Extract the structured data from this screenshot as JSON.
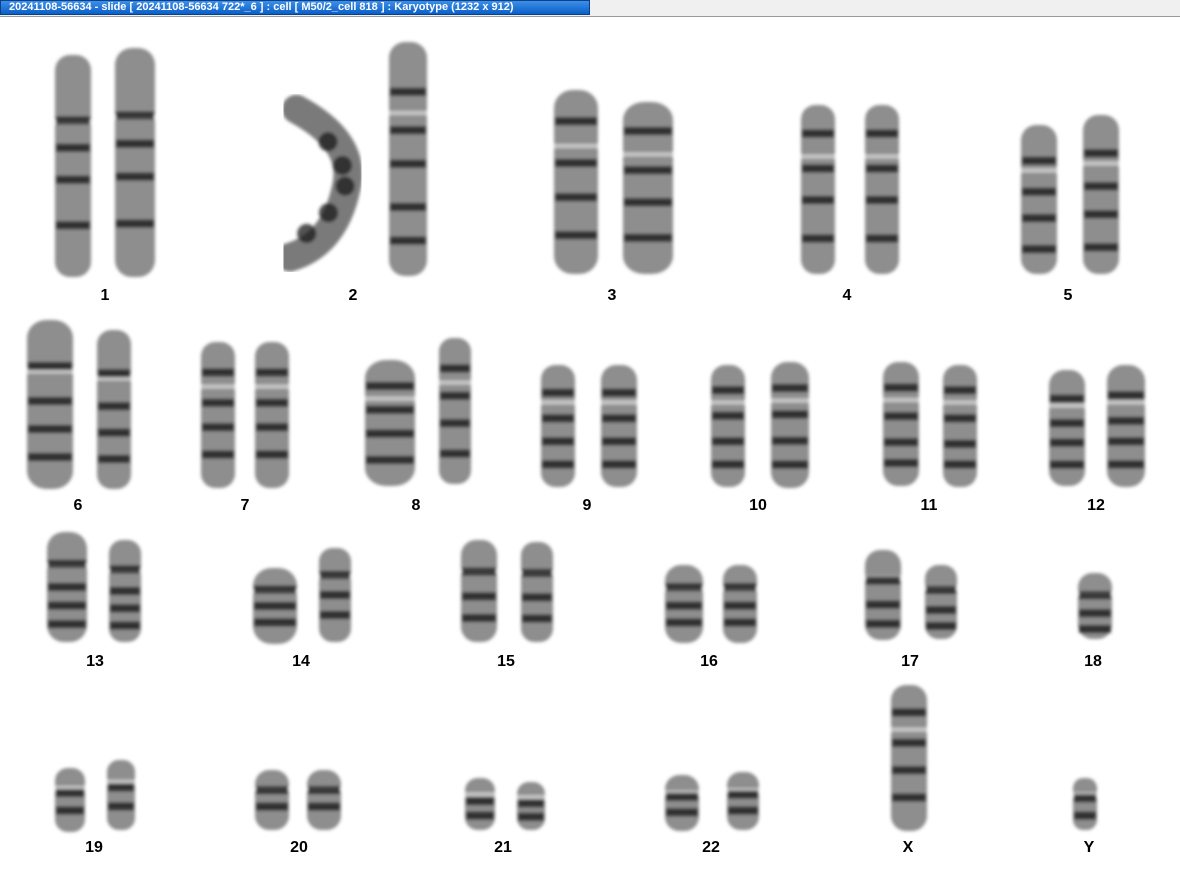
{
  "window": {
    "title": "20241108-56634 - slide [ 20241108-56634 722*_6 ] : cell [ M50/2_cell 818 ] : Karyotype  (1232 x 912)"
  },
  "colors": {
    "title_bar": "#1a6fd6",
    "chromosome": "#7a7a7a",
    "band": "#1a1a1a"
  },
  "karyotype": [
    {
      "label": "1",
      "count": 2
    },
    {
      "label": "2",
      "count": 2
    },
    {
      "label": "3",
      "count": 2
    },
    {
      "label": "4",
      "count": 2
    },
    {
      "label": "5",
      "count": 2
    },
    {
      "label": "6",
      "count": 2
    },
    {
      "label": "7",
      "count": 2
    },
    {
      "label": "8",
      "count": 2
    },
    {
      "label": "9",
      "count": 2
    },
    {
      "label": "10",
      "count": 2
    },
    {
      "label": "11",
      "count": 2
    },
    {
      "label": "12",
      "count": 2
    },
    {
      "label": "13",
      "count": 2
    },
    {
      "label": "14",
      "count": 2
    },
    {
      "label": "15",
      "count": 2
    },
    {
      "label": "16",
      "count": 2
    },
    {
      "label": "17",
      "count": 2
    },
    {
      "label": "18",
      "count": 1
    },
    {
      "label": "19",
      "count": 2
    },
    {
      "label": "20",
      "count": 2
    },
    {
      "label": "21",
      "count": 2
    },
    {
      "label": "22",
      "count": 2
    },
    {
      "label": "X",
      "count": 1
    },
    {
      "label": "Y",
      "count": 1
    }
  ]
}
